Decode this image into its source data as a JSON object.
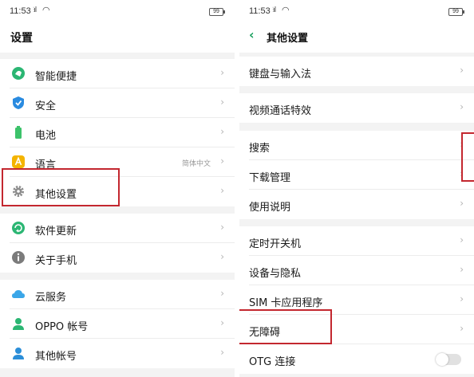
{
  "left": {
    "status": {
      "time": "11:53",
      "battery": "99"
    },
    "title": "设置",
    "items": [
      {
        "label": "智能便捷",
        "icon": "smart-assist-icon"
      },
      {
        "label": "安全",
        "icon": "shield-icon"
      },
      {
        "label": "电池",
        "icon": "battery-icon"
      },
      {
        "label": "语言",
        "icon": "language-icon",
        "value": "简体中文"
      },
      {
        "label": "其他设置",
        "icon": "gear-icon"
      },
      {
        "label": "软件更新",
        "icon": "update-icon"
      },
      {
        "label": "关于手机",
        "icon": "info-icon"
      },
      {
        "label": "云服务",
        "icon": "cloud-icon"
      },
      {
        "label": "OPPO 帐号",
        "icon": "user-icon"
      },
      {
        "label": "其他帐号",
        "icon": "users-icon"
      }
    ]
  },
  "right": {
    "status": {
      "time": "11:53",
      "battery": "99"
    },
    "title": "其他设置",
    "items": [
      {
        "label": "键盘与输入法"
      },
      {
        "label": "视频通话特效"
      },
      {
        "label": "搜索"
      },
      {
        "label": "下载管理"
      },
      {
        "label": "使用说明"
      },
      {
        "label": "定时开关机"
      },
      {
        "label": "设备与隐私"
      },
      {
        "label": "SIM 卡应用程序"
      },
      {
        "label": "无障碍"
      },
      {
        "label": "OTG 连接"
      }
    ]
  },
  "glyphs": {
    "chevron": "›",
    "back": "‹",
    "signal": "⫶ıl",
    "wifi": "◠"
  },
  "colors": {
    "accent_green": "#1aa05e",
    "highlight_red": "#c3272f",
    "divider_gray": "#f3f3f3"
  }
}
